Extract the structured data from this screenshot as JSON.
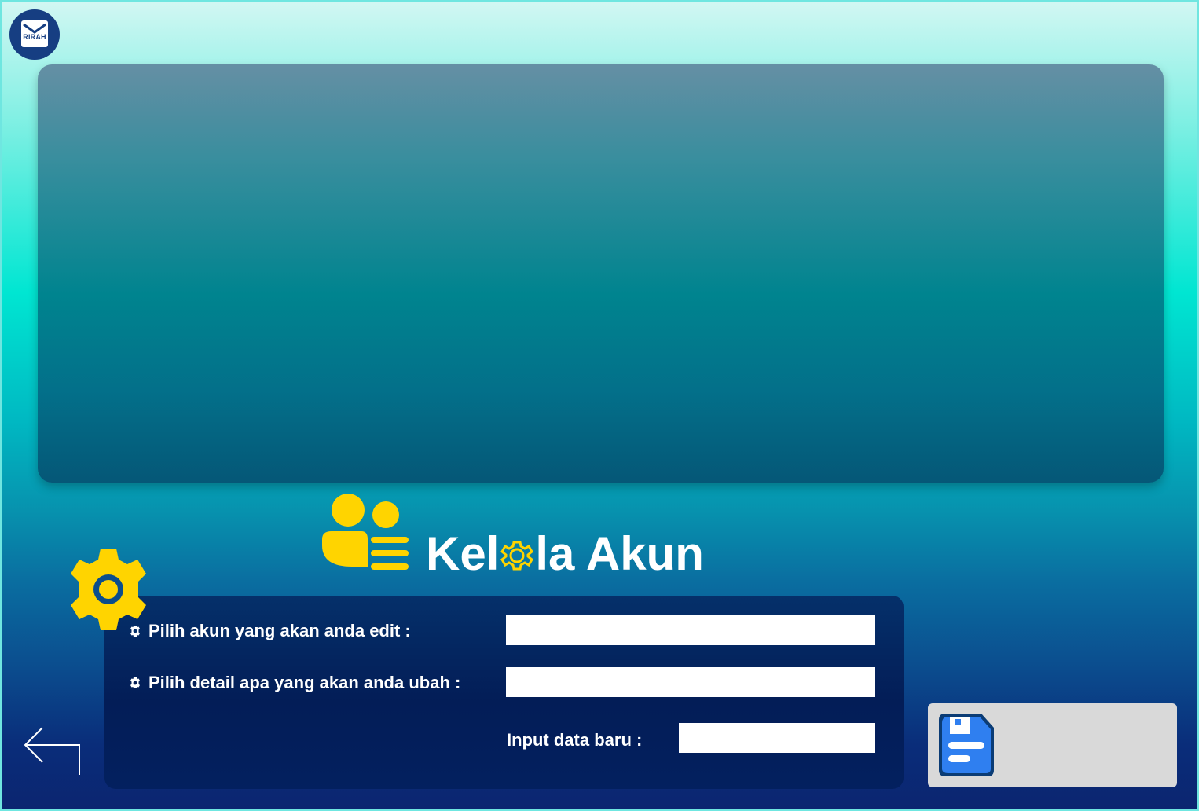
{
  "app": {
    "logo_text": "RiRAH"
  },
  "header": {
    "title_part1": "Kel",
    "title_part2": "la Akun",
    "icon": "users-manage-icon"
  },
  "form": {
    "account_label": "Pilih akun yang akan anda edit :",
    "account_value": "",
    "detail_label": "Pilih detail apa yang akan anda ubah :",
    "detail_value": "",
    "new_data_label": "Input data baru :",
    "new_data_value": ""
  },
  "actions": {
    "back_icon": "back-arrow-icon",
    "save_icon": "floppy-disk-icon"
  },
  "colors": {
    "accent_yellow": "#ffd400",
    "panel_navy": "#031d57",
    "save_blue": "#2f7ff0"
  }
}
